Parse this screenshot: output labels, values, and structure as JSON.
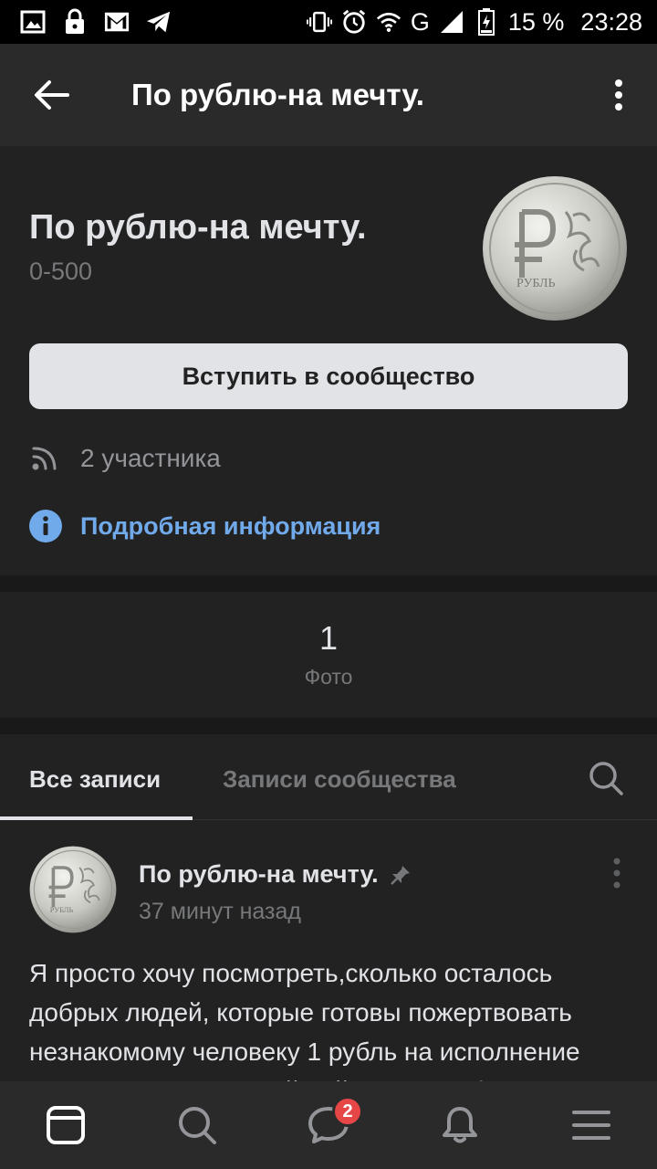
{
  "status_bar": {
    "battery": "15 %",
    "time": "23:28",
    "network": "G",
    "icons": [
      "image-icon",
      "lock-icon",
      "gmail-icon",
      "telegram-icon",
      "vibrate-icon",
      "alarm-icon",
      "wifi-icon",
      "signal-icon",
      "battery-icon"
    ]
  },
  "app_bar": {
    "title": "По рублю-на мечту."
  },
  "group": {
    "name": "По рублю-на мечту.",
    "status": "0-500",
    "join_label": "Вступить в сообщество",
    "members": "2 участника",
    "details_link": "Подробная информация",
    "avatar_text": "РУБЛЬ"
  },
  "counters": {
    "photos_count": "1",
    "photos_label": "Фото"
  },
  "tabs": {
    "all": "Все записи",
    "community": "Записи сообщества"
  },
  "post": {
    "author": "По рублю-на мечту.",
    "time": "37 минут назад",
    "text": "Я просто хочу посмотреть,сколько осталось добрых людей, которые готовы пожертвовать незнакомому человеку 1 рубль на исполнение мечты. Сколько людей найдётся, чтобы..."
  },
  "bottom_nav": {
    "messages_badge": "2",
    "items": [
      "news-icon",
      "search-icon",
      "messages-icon",
      "notifications-icon",
      "menu-icon"
    ]
  },
  "colors": {
    "accent": "#71aaeb",
    "background": "#19191a",
    "card": "#222223",
    "badge": "#e64646"
  }
}
